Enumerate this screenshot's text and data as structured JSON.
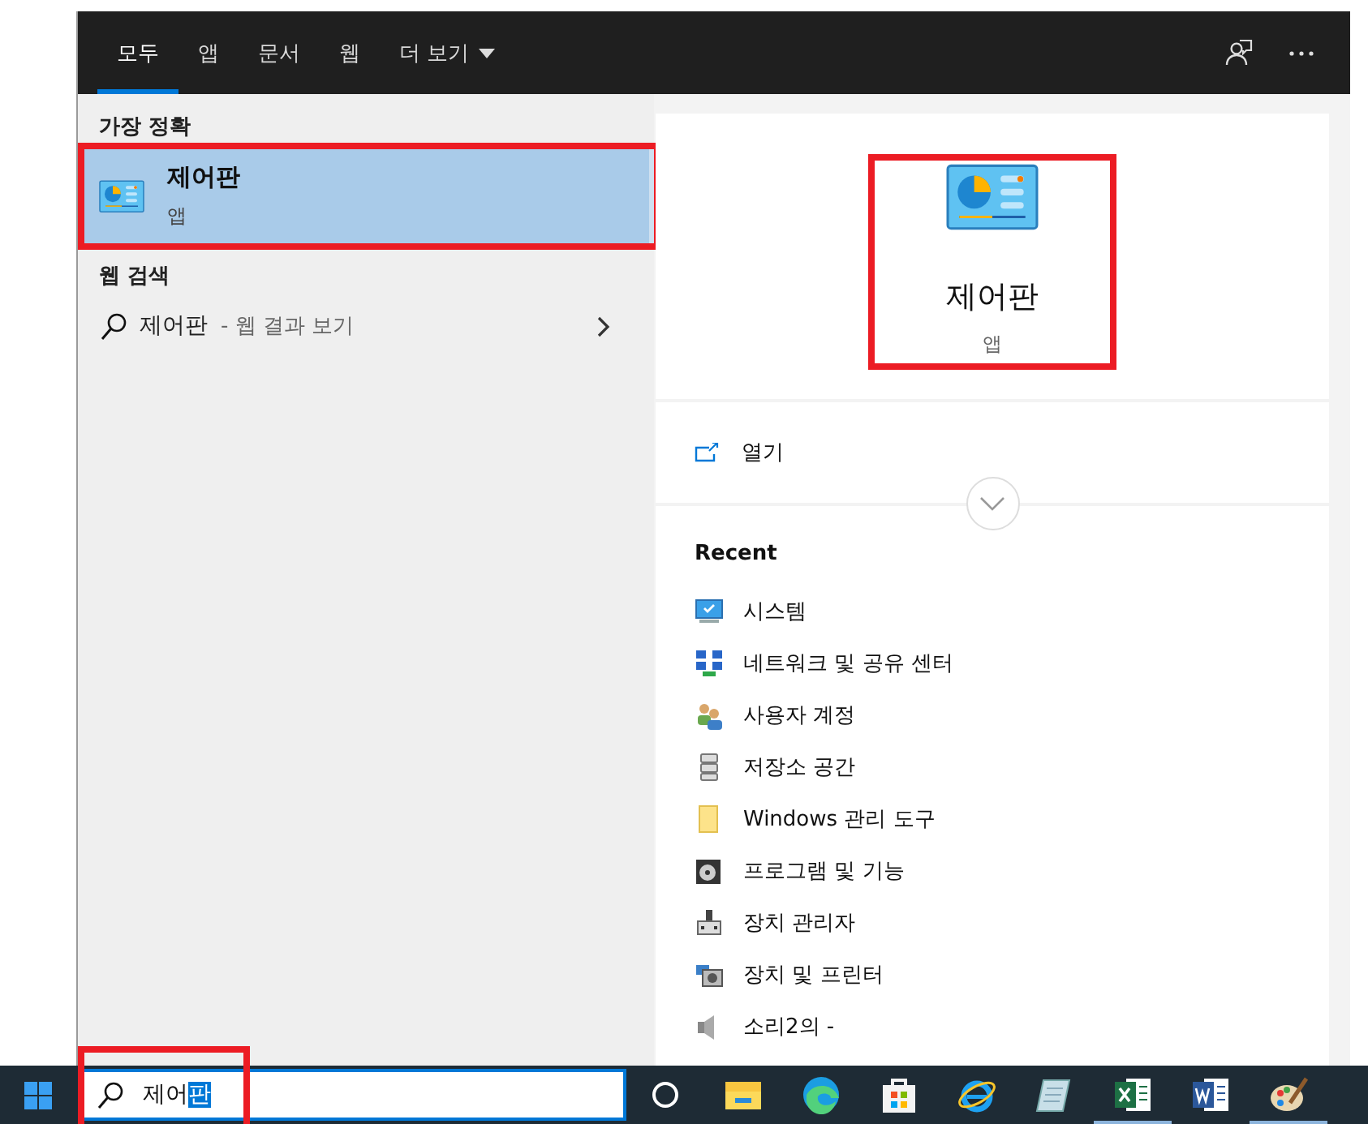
{
  "tabs": [
    {
      "label": "모두",
      "selected": true,
      "dropdown": false
    },
    {
      "label": "앱",
      "selected": false,
      "dropdown": false
    },
    {
      "label": "문서",
      "selected": false,
      "dropdown": false
    },
    {
      "label": "웹",
      "selected": false,
      "dropdown": false
    },
    {
      "label": "더 보기",
      "selected": false,
      "dropdown": true
    }
  ],
  "best_match": {
    "section_label": "가장 정확",
    "title": "제어판",
    "subtitle": "앱",
    "selected": true,
    "highlighted": true
  },
  "web_search": {
    "section_label": "웹 검색",
    "query": "제어판",
    "hint": "- 웹 결과 보기"
  },
  "preview": {
    "title": "제어판",
    "subtitle": "앱",
    "highlighted": true
  },
  "actions": [
    {
      "label": "열기"
    }
  ],
  "recent": {
    "heading": "Recent",
    "items": [
      {
        "label": "시스템",
        "kind": "system"
      },
      {
        "label": "네트워크 및 공유 센터",
        "kind": "network"
      },
      {
        "label": "사용자 계정",
        "kind": "users"
      },
      {
        "label": "저장소 공간",
        "kind": "storage"
      },
      {
        "label": "Windows 관리 도구",
        "kind": "folder"
      },
      {
        "label": "프로그램 및 기능",
        "kind": "programs"
      },
      {
        "label": "장치 관리자",
        "kind": "devices"
      },
      {
        "label": "장치 및 프린터",
        "kind": "printers"
      },
      {
        "label": "소리2의 -",
        "kind": "sound"
      }
    ]
  },
  "taskbar": {
    "search": {
      "value": "제어",
      "selection": "판",
      "highlighted": true
    },
    "apps": [
      {
        "kind": "cortana",
        "running": false
      },
      {
        "kind": "explorer",
        "running": false
      },
      {
        "kind": "edge",
        "running": false
      },
      {
        "kind": "store",
        "running": false
      },
      {
        "kind": "ie",
        "running": false
      },
      {
        "kind": "notepad",
        "running": false
      },
      {
        "kind": "excel",
        "running": true
      },
      {
        "kind": "word",
        "running": false
      },
      {
        "kind": "paint",
        "running": true
      }
    ]
  }
}
